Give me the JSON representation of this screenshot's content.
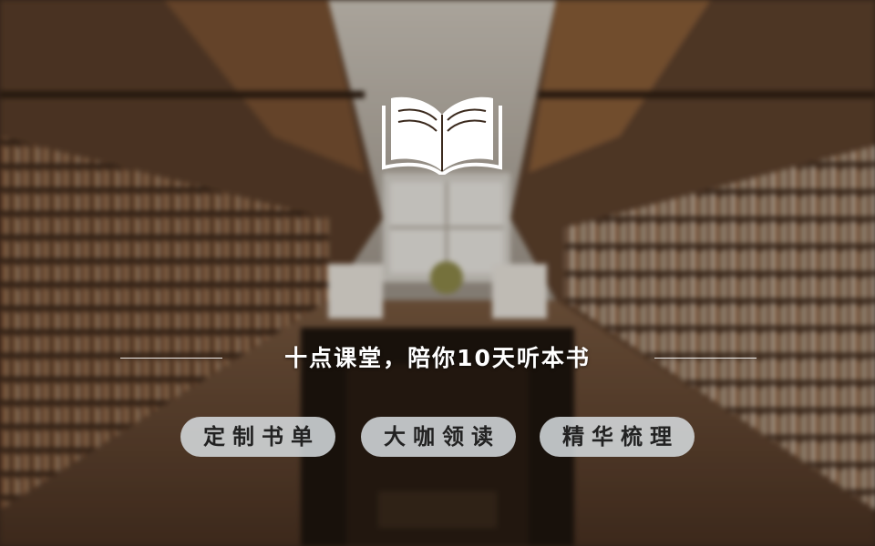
{
  "banner": {
    "tagline": "十点课堂，陪你10天听本书",
    "features": [
      {
        "label": "定制书单"
      },
      {
        "label": "大咖领读"
      },
      {
        "label": "精华梳理"
      }
    ],
    "icon": "open-book-icon",
    "colors": {
      "text": "#ffffff",
      "pill_bg": "#d8dee2",
      "pill_text": "#222222"
    }
  }
}
